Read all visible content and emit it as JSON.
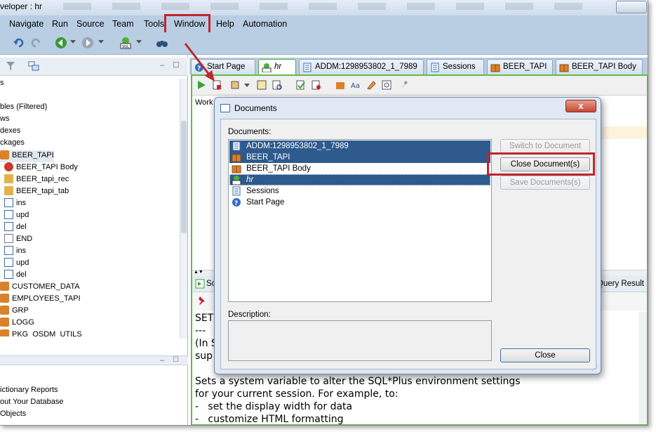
{
  "window": {
    "title": "veloper : hr"
  },
  "menubar": {
    "items": [
      "Navigate",
      "Run",
      "Source",
      "Team",
      "Tools",
      "Window",
      "Help",
      "Automation"
    ],
    "highlighted": "Window"
  },
  "left_panel": {
    "tree_items": [
      "s",
      "bles (Filtered)",
      "ws",
      "dexes",
      "ckages",
      "BEER_TAPI",
      "BEER_TAPI Body",
      "BEER_tapi_rec",
      "BEER_tapi_tab",
      "ins",
      "upd",
      "del",
      "END",
      "ins",
      "upd",
      "del",
      "CUSTOMER_DATA",
      "EMPLOYEES_TAPI",
      "GRP",
      "LOGG",
      "PKG_OSDM_UTILS"
    ],
    "lower_items": [
      "ictionary Reports",
      "out Your Database",
      "Objects"
    ]
  },
  "tabs": [
    {
      "label": "Start Page",
      "icon": "help-icon"
    },
    {
      "label": "hr",
      "icon": "sql-worksheet-icon",
      "active": true
    },
    {
      "label": "ADDM:1298953802_1_7989",
      "icon": "report-icon"
    },
    {
      "label": "Sessions",
      "icon": "report-icon"
    },
    {
      "label": "BEER_TAPI",
      "icon": "package-icon"
    },
    {
      "label": "BEER_TAPI Body",
      "icon": "package-icon"
    }
  ],
  "editor": {
    "worksheet_tab": "Work",
    "lower_tab_label": "So",
    "query_result": "Query Result",
    "help_lines": [
      "SET",
      "---",
      "(In S",
      "sup",
      "",
      "Sets a system variable to alter the SQL*Plus environment settings",
      "for your current session. For example, to:",
      "-   set the display width for data",
      "-   customize HTML formatting"
    ]
  },
  "dialog": {
    "title": "Documents",
    "documents_label": "Documents:",
    "description_label": "Description:",
    "documents": [
      {
        "name": "ADDM:1298953802_1_7989",
        "icon": "report-icon",
        "selected": true
      },
      {
        "name": "BEER_TAPI",
        "icon": "package-icon",
        "selected": true
      },
      {
        "name": "BEER_TAPI Body",
        "icon": "package-icon",
        "selected": false
      },
      {
        "name": "hr",
        "icon": "sql-worksheet-icon",
        "selected": true
      },
      {
        "name": "Sessions",
        "icon": "report-icon",
        "selected": false
      },
      {
        "name": "Start Page",
        "icon": "help-icon",
        "selected": false
      }
    ],
    "buttons": {
      "switch": "Switch to Document",
      "close_docs": "Close Document(s)",
      "save_docs": "Save Documents(s)",
      "close": "Close"
    },
    "close_x": "x"
  },
  "colors": {
    "highlight_red": "#c0262d",
    "selection_blue": "#2e5a8d",
    "active_tab_green": "#5dbe3f"
  }
}
